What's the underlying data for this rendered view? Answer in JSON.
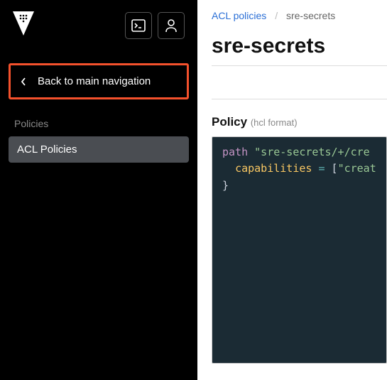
{
  "sidebar": {
    "back_label": "Back to main navigation",
    "section_label": "Policies",
    "nav_item_label": "ACL Policies"
  },
  "breadcrumb": {
    "parent": "ACL policies",
    "current": "sre-secrets"
  },
  "page": {
    "title": "sre-secrets"
  },
  "policy": {
    "heading": "Policy",
    "format_hint": "(hcl format)",
    "code": {
      "kw_path": "path",
      "path_value": "\"sre-secrets/+/cre",
      "ident_caps": "capabilities",
      "eq": " = ",
      "bracket": "[",
      "cap_value": "\"creat",
      "close": "}"
    }
  }
}
